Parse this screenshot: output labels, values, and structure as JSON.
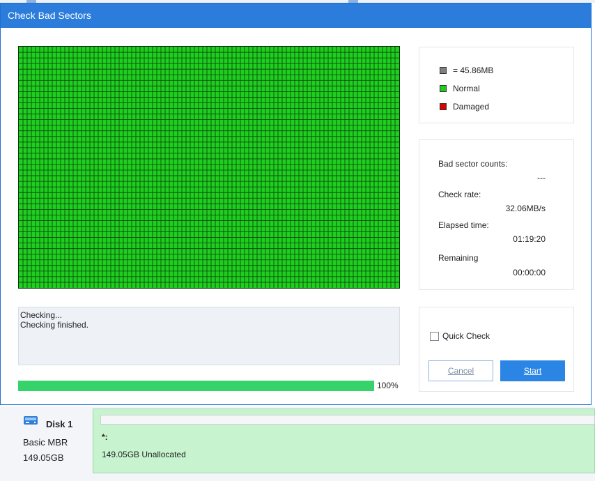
{
  "dialog": {
    "title": "Check Bad Sectors"
  },
  "legend": {
    "items": [
      {
        "label": "= 45.86MB",
        "color": "#808080"
      },
      {
        "label": "Normal",
        "color": "#22cc22"
      },
      {
        "label": "Damaged",
        "color": "#dd0000"
      }
    ]
  },
  "stats": {
    "bad_sector_label": "Bad sector counts:",
    "bad_sector_value": "---",
    "check_rate_label": "Check rate:",
    "check_rate_value": "32.06MB/s",
    "elapsed_label": "Elapsed time:",
    "elapsed_value": "01:19:20",
    "remaining_label": "Remaining",
    "remaining_value": "00:00:00"
  },
  "log": {
    "lines": [
      "Checking...",
      "Checking finished."
    ]
  },
  "progress": {
    "percent": 100,
    "label": "100%"
  },
  "actions": {
    "quick_check_label": "Quick Check",
    "quick_check_checked": false,
    "cancel_label": "Cancel",
    "start_label": "Start"
  },
  "disk": {
    "name": "Disk 1",
    "type": "Basic MBR",
    "size": "149.05GB",
    "partition_letter": "*:",
    "partition_desc": "149.05GB Unallocated"
  },
  "colors": {
    "titlebar": "#2b7cdb",
    "sector_normal": "#1fcf1f",
    "progress": "#35d36a",
    "start_button": "#2b85e4"
  }
}
